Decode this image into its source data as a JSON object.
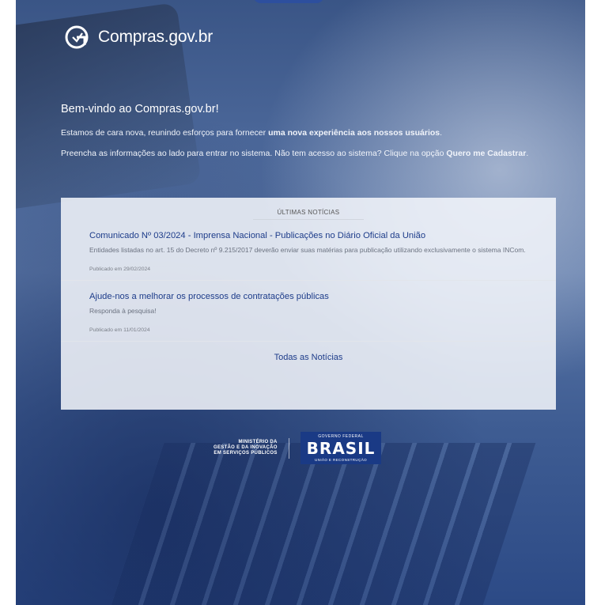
{
  "brand": {
    "name": "Compras.gov.br"
  },
  "welcome": {
    "heading": "Bem-vindo ao Compras.gov.br!",
    "line1_text": "Estamos de cara nova, reunindo esforços para fornecer ",
    "line1_bold": "uma nova experiência aos nossos usuários",
    "line1_end": ".",
    "line2_text": "Preencha as informações ao lado para entrar no sistema. Não tem acesso ao sistema? Clique na opção ",
    "line2_bold": "Quero me Cadastrar",
    "line2_end": "."
  },
  "news": {
    "title": "ÚLTIMAS NOTÍCIAS",
    "items": [
      {
        "headline": "Comunicado Nº 03/2024 - Imprensa Nacional - Publicações no Diário Oficial da União",
        "summary": "Entidades listadas no art. 15 do Decreto nº 9.215/2017 deverão enviar suas matérias para publicação utilizando exclusivamente o sistema INCom.",
        "date": "Publicado em 29/02/2024"
      },
      {
        "headline": "Ajude-nos a melhorar os processos de contratações públicas",
        "summary": "Responda à pesquisa!",
        "date": "Publicado em 11/01/2024"
      }
    ],
    "all_link": "Todas as Notícias"
  },
  "footer": {
    "ministry_line1": "MINISTÉRIO DA",
    "ministry_line2": "GESTÃO E DA INOVAÇÃO",
    "ministry_line3": "EM SERVIÇOS PÚBLICOS",
    "gov_label": "GOVERNO FEDERAL",
    "brasil_word": "BRASIL",
    "brasil_sub": "UNIÃO E RECONSTRUÇÃO"
  },
  "colors": {
    "accent": "#1d3c8a",
    "background": "#4a6698"
  }
}
